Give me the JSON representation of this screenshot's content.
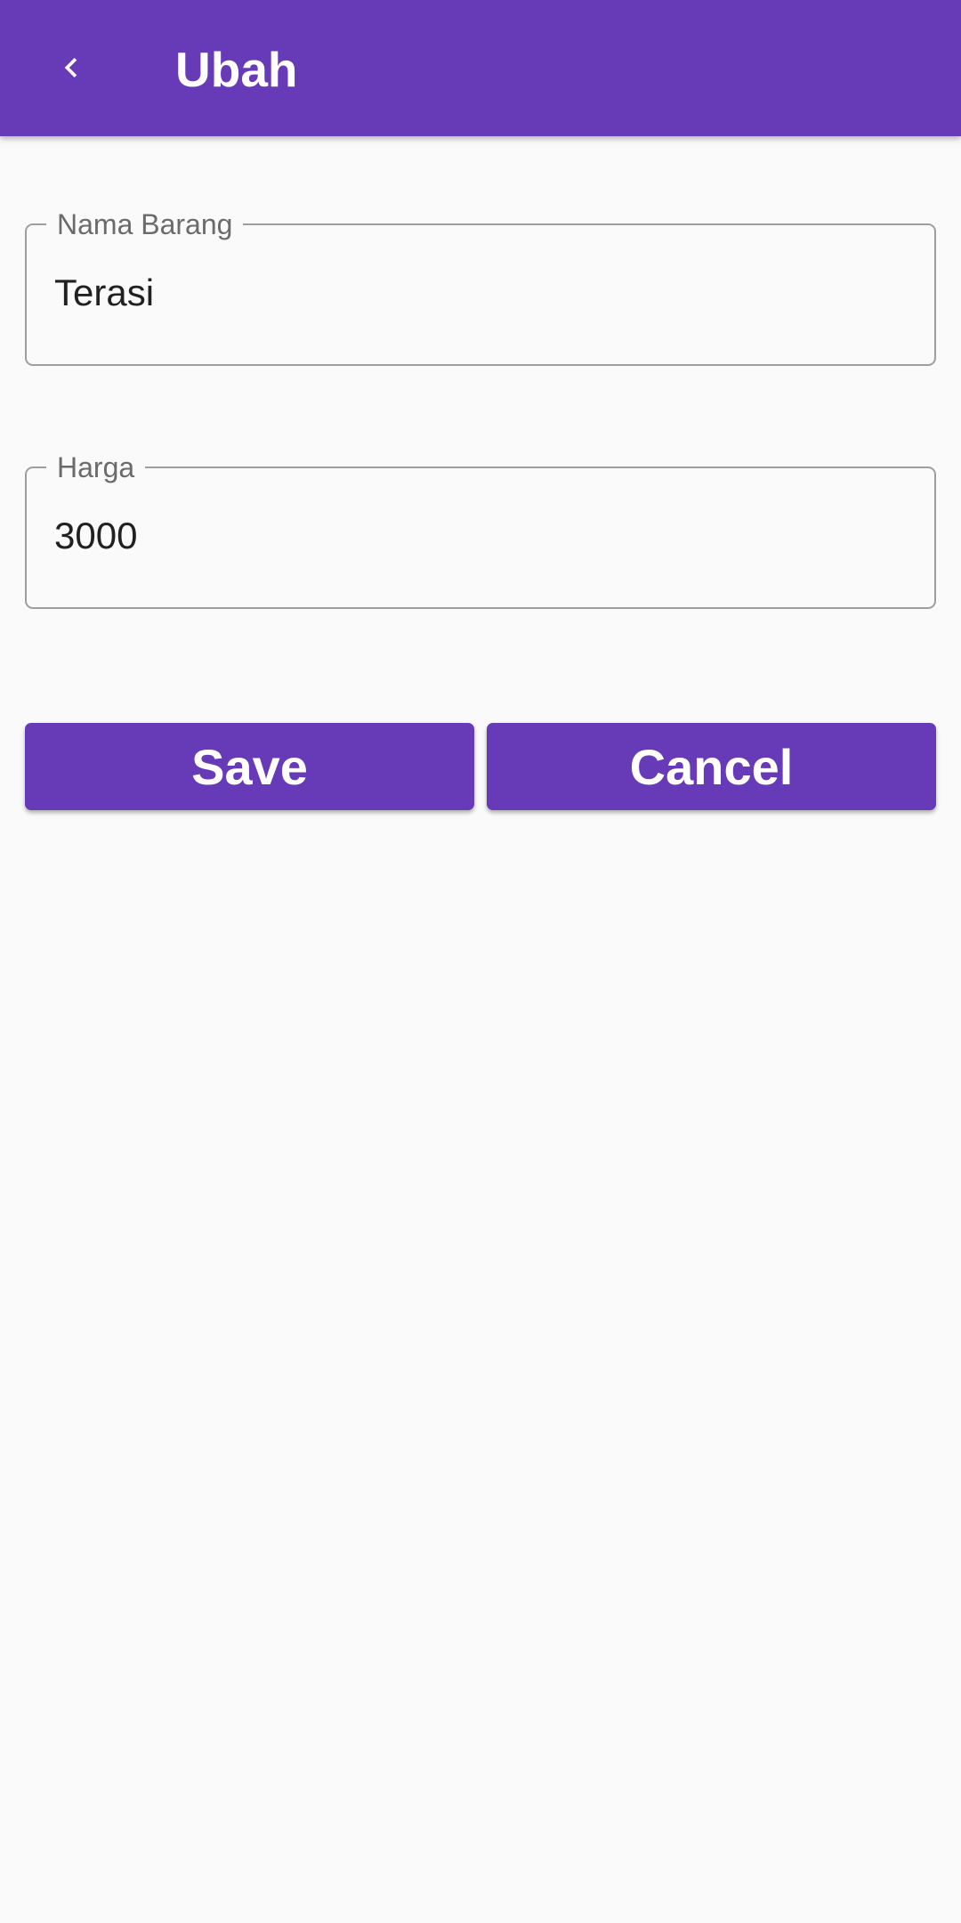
{
  "app_bar": {
    "title": "Ubah",
    "back_icon": "chevron-left-icon",
    "background": "#673ab7"
  },
  "form": {
    "nama_barang": {
      "label": "Nama Barang",
      "value": "Terasi"
    },
    "harga": {
      "label": "Harga",
      "value": "3000"
    }
  },
  "actions": {
    "save_label": "Save",
    "cancel_label": "Cancel",
    "button_color": "#673ab7"
  }
}
